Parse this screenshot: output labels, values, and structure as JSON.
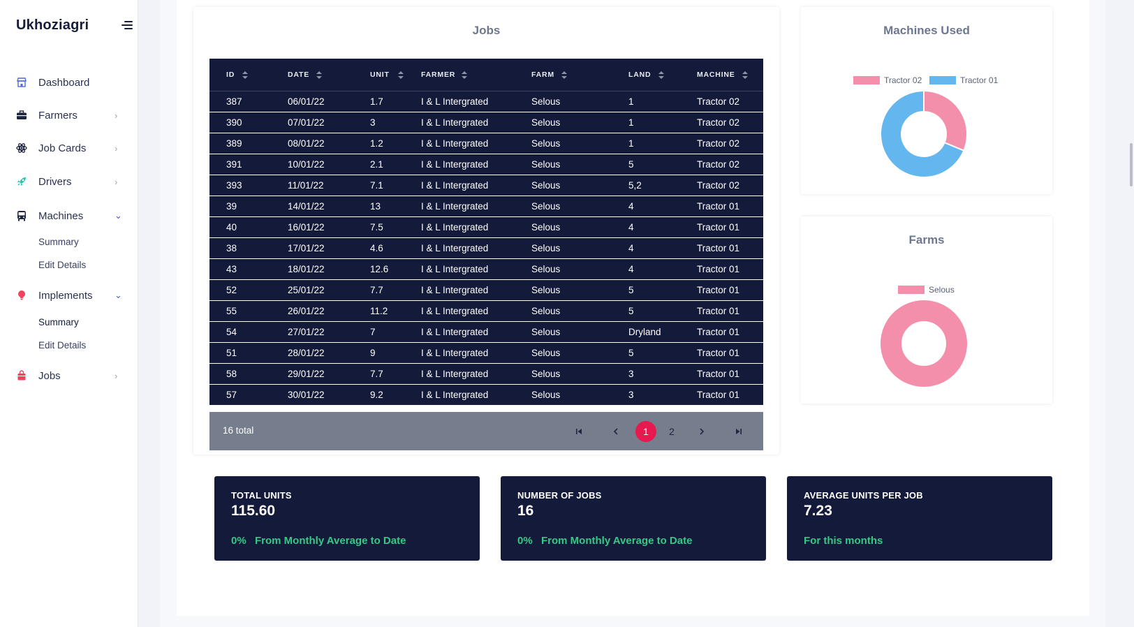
{
  "sidebar": {
    "brand": "Ukhoziagri",
    "items": [
      {
        "label": "Dashboard"
      },
      {
        "label": "Farmers"
      },
      {
        "label": "Job Cards"
      },
      {
        "label": "Drivers"
      },
      {
        "label": "Machines",
        "sub": [
          "Summary",
          "Edit Details"
        ]
      },
      {
        "label": "Implements",
        "sub": [
          "Summary",
          "Edit Details"
        ]
      },
      {
        "label": "Jobs"
      }
    ]
  },
  "jobs": {
    "title": "Jobs",
    "columns": [
      "ID",
      "DATE",
      "UNIT",
      "FARMER",
      "FARM",
      "LAND",
      "MACHINE"
    ],
    "rows": [
      [
        "387",
        "06/01/22",
        "1.7",
        "I & L Intergrated",
        "Selous",
        "1",
        "Tractor 02"
      ],
      [
        "390",
        "07/01/22",
        "3",
        "I & L Intergrated",
        "Selous",
        "1",
        "Tractor 02"
      ],
      [
        "389",
        "08/01/22",
        "1.2",
        "I & L Intergrated",
        "Selous",
        "1",
        "Tractor 02"
      ],
      [
        "391",
        "10/01/22",
        "2.1",
        "I & L Intergrated",
        "Selous",
        "5",
        "Tractor 02"
      ],
      [
        "393",
        "11/01/22",
        "7.1",
        "I & L Intergrated",
        "Selous",
        "5,2",
        "Tractor 02"
      ],
      [
        "39",
        "14/01/22",
        "13",
        "I & L Intergrated",
        "Selous",
        "4",
        "Tractor 01"
      ],
      [
        "40",
        "16/01/22",
        "7.5",
        "I & L Intergrated",
        "Selous",
        "4",
        "Tractor 01"
      ],
      [
        "38",
        "17/01/22",
        "4.6",
        "I & L Intergrated",
        "Selous",
        "4",
        "Tractor 01"
      ],
      [
        "43",
        "18/01/22",
        "12.6",
        "I & L Intergrated",
        "Selous",
        "4",
        "Tractor 01"
      ],
      [
        "52",
        "25/01/22",
        "7.7",
        "I & L Intergrated",
        "Selous",
        "5",
        "Tractor 01"
      ],
      [
        "55",
        "26/01/22",
        "11.2",
        "I & L Intergrated",
        "Selous",
        "5",
        "Tractor 01"
      ],
      [
        "54",
        "27/01/22",
        "7",
        "I & L Intergrated",
        "Selous",
        "Dryland",
        "Tractor 01"
      ],
      [
        "51",
        "28/01/22",
        "9",
        "I & L Intergrated",
        "Selous",
        "5",
        "Tractor 01"
      ],
      [
        "58",
        "29/01/22",
        "7.7",
        "I & L Intergrated",
        "Selous",
        "3",
        "Tractor 01"
      ],
      [
        "57",
        "30/01/22",
        "9.2",
        "I & L Intergrated",
        "Selous",
        "3",
        "Tractor 01"
      ]
    ],
    "total": "16 total",
    "pages": [
      "1",
      "2"
    ],
    "current_page": "1"
  },
  "machines_chart": {
    "title": "Machines Used",
    "legend": [
      "Tractor 02",
      "Tractor 01"
    ]
  },
  "farms_chart": {
    "title": "Farms",
    "legend": [
      "Selous"
    ]
  },
  "chart_data": [
    {
      "type": "pie",
      "title": "Machines Used",
      "categories": [
        "Tractor 02",
        "Tractor 01"
      ],
      "values": [
        5,
        11
      ],
      "colors": [
        "#f48fab",
        "#63b6ee"
      ],
      "legend": "top"
    },
    {
      "type": "pie",
      "title": "Farms",
      "categories": [
        "Selous"
      ],
      "values": [
        16
      ],
      "colors": [
        "#f48fab"
      ],
      "legend": "top"
    }
  ],
  "stats": [
    {
      "label": "TOTAL UNITS",
      "value": "115.60",
      "pct": "0%",
      "note": "From Monthly Average to Date"
    },
    {
      "label": "NUMBER OF JOBS",
      "value": "16",
      "pct": "0%",
      "note": "From Monthly Average to Date"
    },
    {
      "label": "AVERAGE UNITS PER JOB",
      "value": "7.23",
      "pct": "",
      "note": "For this months"
    }
  ],
  "colors": {
    "navy": "#141b3a",
    "accent_pink": "#e8194e",
    "green": "#36c985",
    "sidebar_accent": "#3d5bd9"
  }
}
